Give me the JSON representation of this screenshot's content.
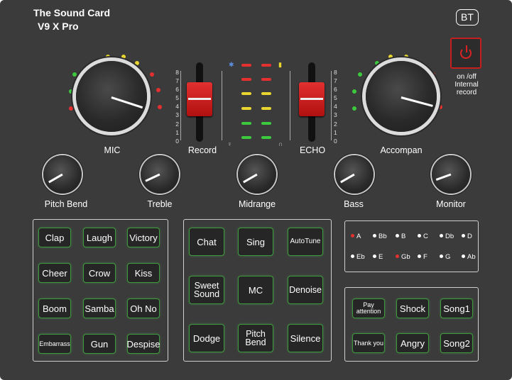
{
  "header": {
    "title_line1": "The Sound Card",
    "title_line2": "V9 X Pro",
    "bt_label": "BT"
  },
  "power": {
    "label": "on /off\nInternal\nrecord"
  },
  "knobs": {
    "mic_label": "MIC",
    "accompan_label": "Accompan",
    "pitch_bend_label": "Pitch Bend",
    "treble_label": "Treble",
    "midrange_label": "Midrange",
    "bass_label": "Bass",
    "monitor_label": "Monitor"
  },
  "faders": {
    "record_label": "Record",
    "echo_label": "ECHO",
    "scale": [
      "8",
      "7",
      "6",
      "5",
      "4",
      "3",
      "2",
      "1",
      "0"
    ]
  },
  "vu_colors": {
    "red": "#e53030",
    "yellow": "#e8d530",
    "green": "#3dc93d"
  },
  "effects_left": [
    [
      "Clap",
      "Laugh",
      "Victory"
    ],
    [
      "Cheer",
      "Crow",
      "Kiss"
    ],
    [
      "Boom",
      "Samba",
      "Oh No"
    ],
    [
      "Embarrass",
      "Gun",
      "Despise"
    ]
  ],
  "effects_mid": [
    [
      "Chat",
      "Sing",
      "AutoTune"
    ],
    [
      "Sweet\nSound",
      "MC",
      "Denoise"
    ],
    [
      "Dodge",
      "Pitch\nBend",
      "Silence"
    ]
  ],
  "keys": {
    "row1": [
      "A",
      "Bb",
      "B",
      "C",
      "Db",
      "D"
    ],
    "row2": [
      "Eb",
      "E",
      "Gb",
      "F",
      "G",
      "Ab"
    ],
    "active": [
      "A",
      "Gb"
    ]
  },
  "effects_right": [
    [
      "Pay\nattention",
      "Shock",
      "Song1"
    ],
    [
      "Thank you",
      "Angry",
      "Song2"
    ]
  ],
  "accent_colors": {
    "panel": "#3b3b3b",
    "button_border": "#3f9a3f",
    "power_red": "#c41e1e"
  }
}
